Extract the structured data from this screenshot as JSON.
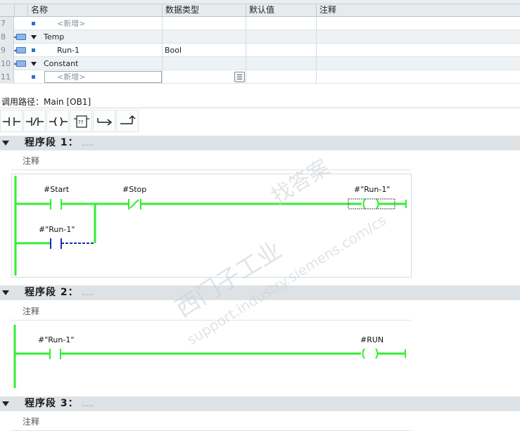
{
  "interface_table": {
    "section_title_clipped": "Temp Constant",
    "columns": {
      "name": "名称",
      "data_type": "数据类型",
      "default_value": "默认值",
      "comment": "注释"
    },
    "rows": [
      {
        "num": "7",
        "name": "<新增>",
        "type": "",
        "kind": "placeholder"
      },
      {
        "num": "8",
        "name": "Temp",
        "type": "",
        "kind": "section"
      },
      {
        "num": "9",
        "name": "Run-1",
        "type": "Bool",
        "kind": "variable"
      },
      {
        "num": "10",
        "name": "Constant",
        "type": "",
        "kind": "section"
      },
      {
        "num": "11",
        "name": "<新增>",
        "type": "",
        "kind": "placeholder-edit"
      }
    ]
  },
  "call_path": {
    "label": "调用路径：Main [OB1]"
  },
  "toolbar": {
    "buttons": [
      {
        "name": "normally-open-contact-button",
        "icon": "no-contact-icon"
      },
      {
        "name": "normally-closed-contact-button",
        "icon": "nc-contact-icon"
      },
      {
        "name": "coil-button",
        "icon": "coil-icon"
      },
      {
        "name": "empty-box-button",
        "icon": "box-icon",
        "glyph": "??"
      },
      {
        "name": "open-branch-button",
        "icon": "open-branch-icon"
      },
      {
        "name": "close-branch-button",
        "icon": "close-branch-icon"
      }
    ]
  },
  "networks": [
    {
      "title": "程序段 1：",
      "dots": ".....",
      "comment": "注释",
      "contacts": [
        "#Start",
        "#Stop",
        "#\"Run-1\""
      ],
      "coil": "#\"Run-1\""
    },
    {
      "title": "程序段 2：",
      "dots": ".....",
      "comment": "注释",
      "contacts": [
        "#\"Run-1\""
      ],
      "coil": "#RUN"
    },
    {
      "title": "程序段 3：",
      "dots": ".....",
      "comment": "注释"
    }
  ],
  "watermark": {
    "line1": "西门子工业",
    "line2": "找答案",
    "line3": "support.industry.siemens.com/cs"
  },
  "colors": {
    "rung": "#33ee33",
    "pending": "#1a2fa8",
    "link": "#2f6fc6"
  }
}
